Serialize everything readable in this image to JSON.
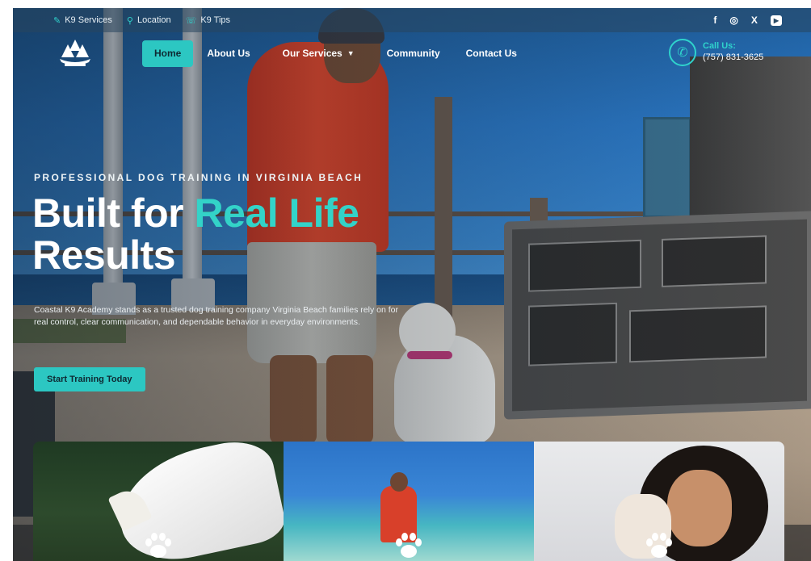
{
  "topbar": {
    "links": [
      {
        "icon": "paw-icon",
        "label": "K9 Services"
      },
      {
        "icon": "location-pin-icon",
        "label": "Location"
      },
      {
        "icon": "phone-icon",
        "label": "K9 Tips"
      }
    ],
    "socials": [
      {
        "icon": "facebook-icon",
        "glyph": "f"
      },
      {
        "icon": "instagram-icon",
        "glyph": "◎"
      },
      {
        "icon": "x-icon",
        "glyph": "X"
      },
      {
        "icon": "youtube-icon",
        "glyph": "▶"
      }
    ]
  },
  "nav": {
    "items": [
      {
        "label": "Home",
        "active": true
      },
      {
        "label": "About Us"
      },
      {
        "label": "Our Services",
        "dropdown": true
      },
      {
        "label": "Community"
      },
      {
        "label": "Contact Us"
      }
    ],
    "call_label": "Call Us:",
    "call_number": "(757) 831-3625"
  },
  "hero": {
    "eyebrow": "PROFESSIONAL DOG TRAINING IN VIRGINIA BEACH",
    "headline_part1": "Built for ",
    "headline_accent": "Real Life",
    "headline_part2": "Results",
    "description": "Coastal K9 Academy stands as a trusted dog training company Virginia Beach families rely on for real control, clear communication, and dependable behavior in everyday environments.",
    "cta": "Start Training Today"
  },
  "colors": {
    "accent": "#2cc7c2",
    "accent_text": "#33d3c8"
  }
}
